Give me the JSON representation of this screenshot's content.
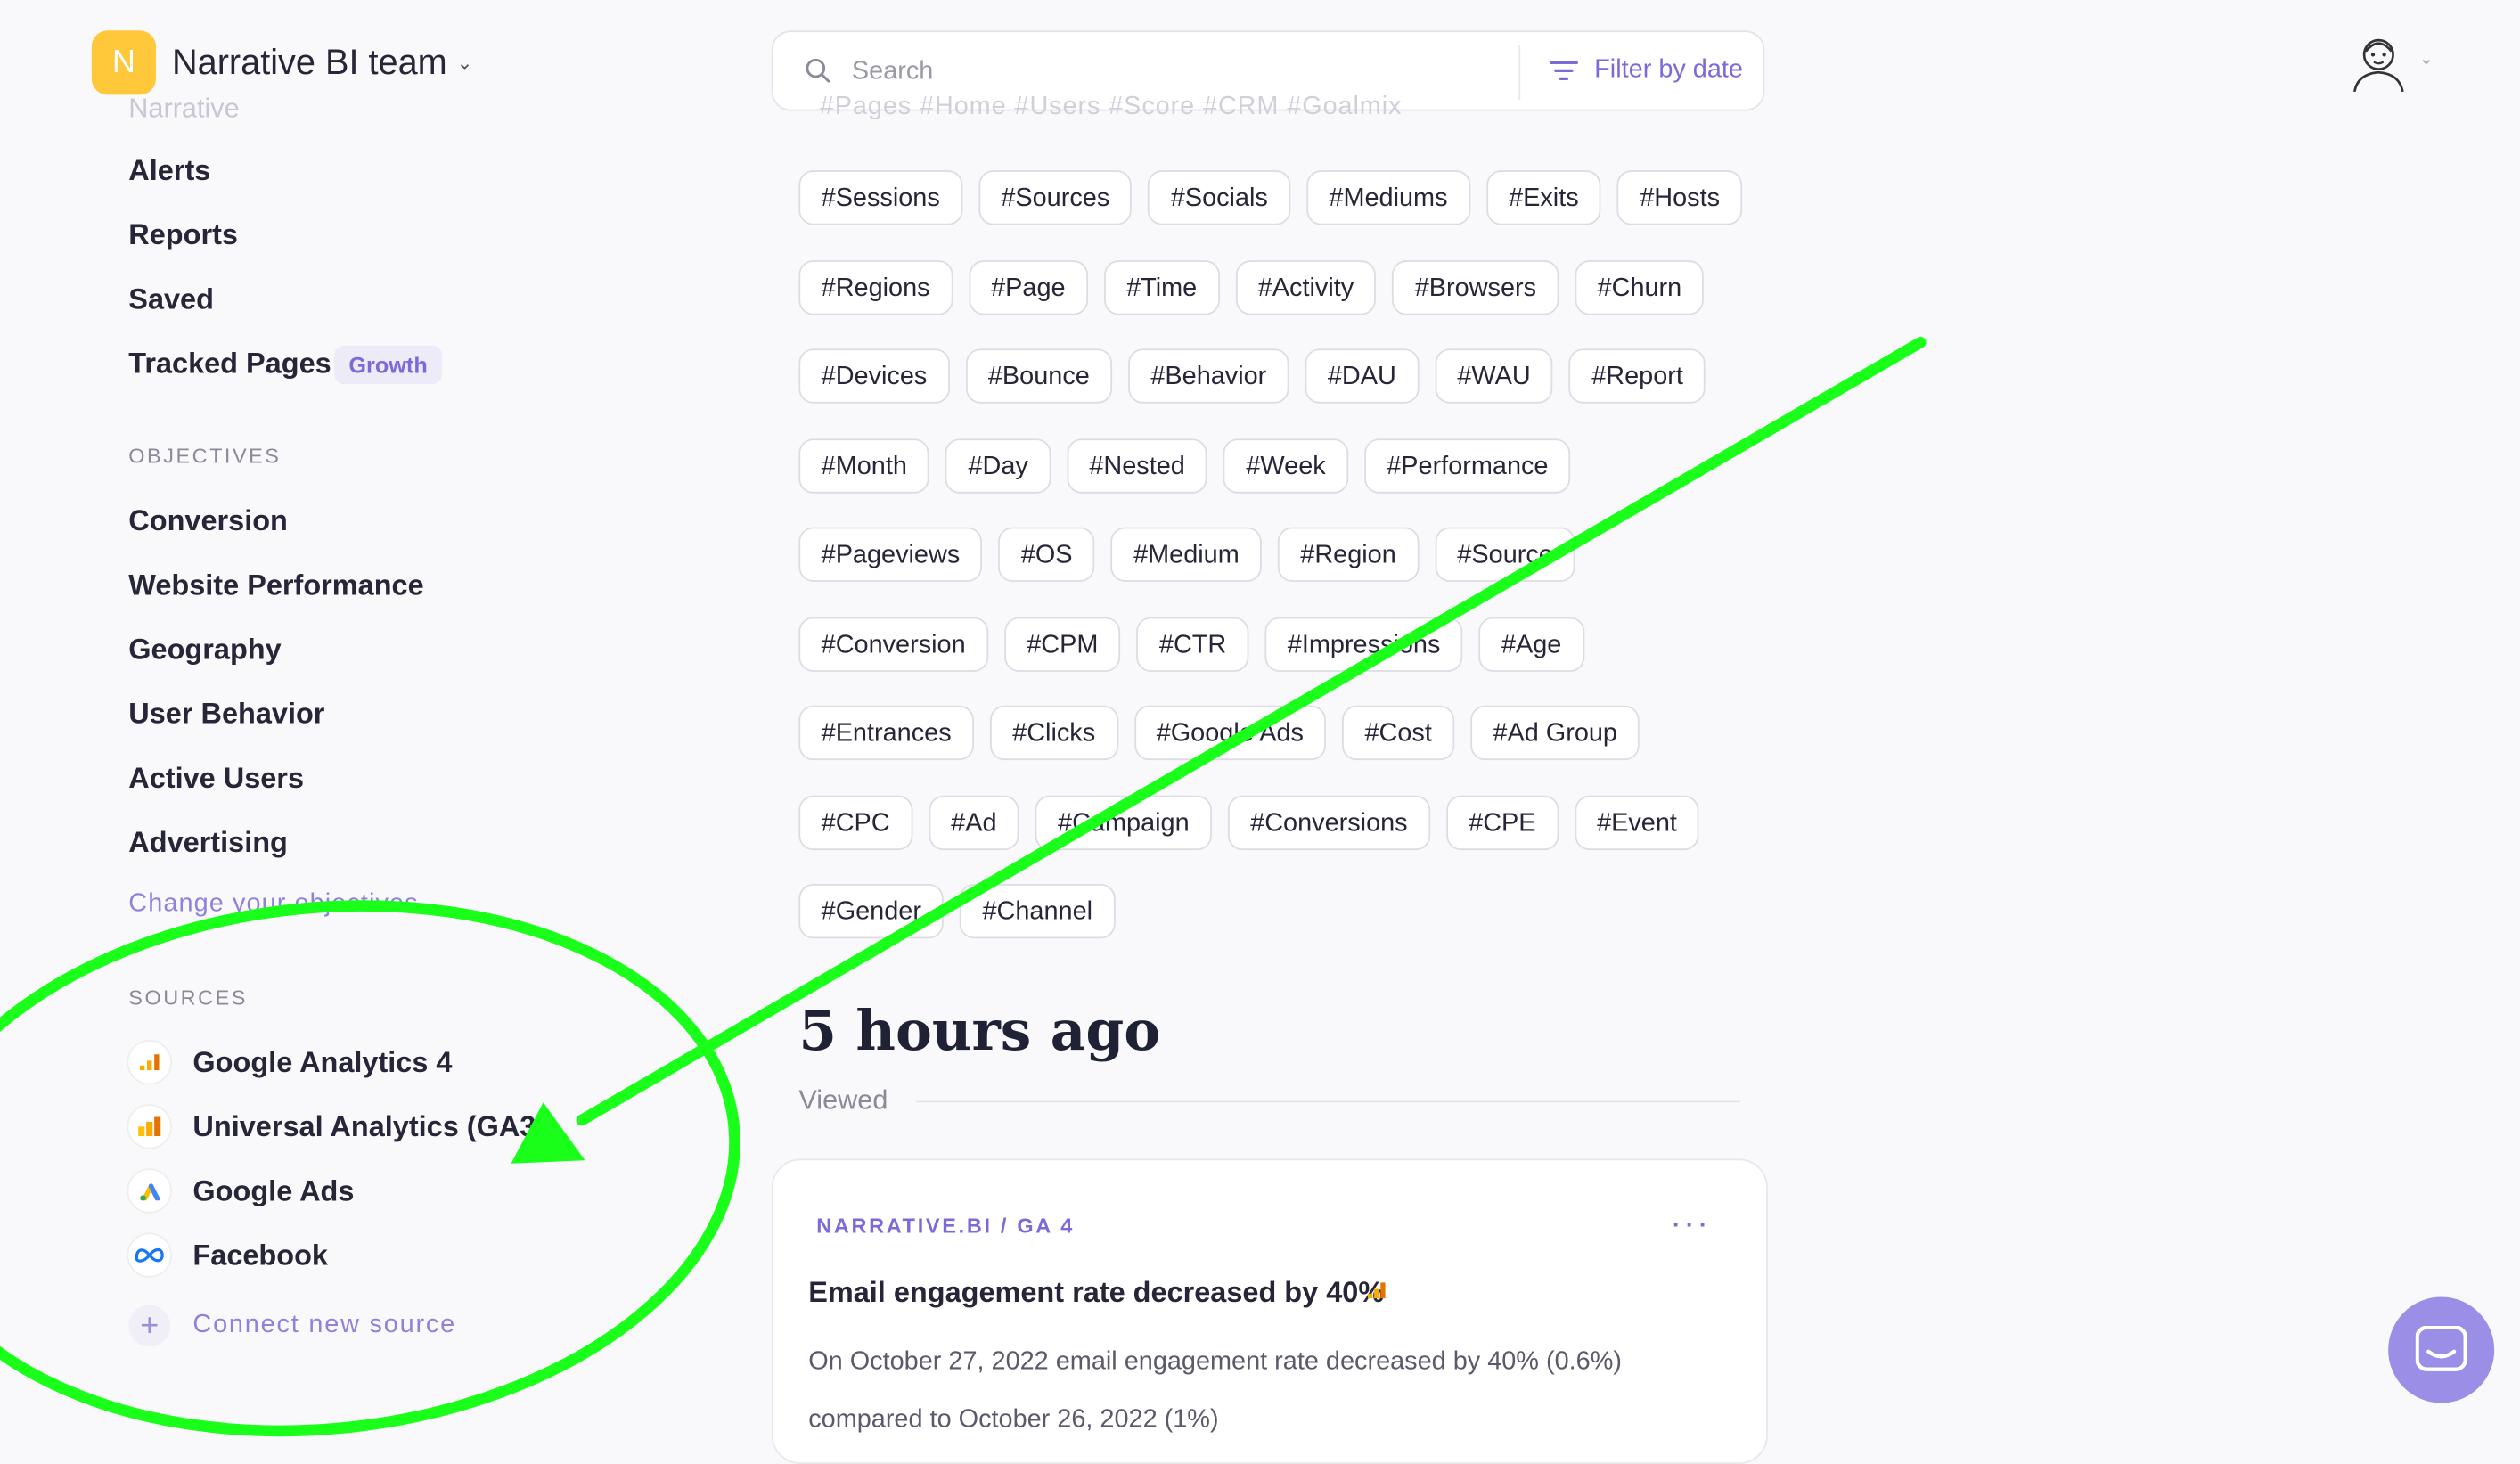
{
  "header": {
    "team_initial": "N",
    "team_name": "Narrative BI team",
    "search_placeholder": "Search",
    "filter_label": "Filter by date"
  },
  "sidebar": {
    "ghost_item": "Narrative",
    "nav_items": [
      "Alerts",
      "Reports",
      "Saved",
      "Tracked Pages"
    ],
    "tracked_badge": "Growth",
    "objectives_label": "OBJECTIVES",
    "objectives": [
      "Conversion",
      "Website Performance",
      "Geography",
      "User Behavior",
      "Active Users",
      "Advertising"
    ],
    "change_link": "Change your objectives",
    "sources_label": "SOURCES",
    "sources": [
      "Google Analytics 4",
      "Universal Analytics (GA3)",
      "Google Ads",
      "Facebook"
    ],
    "connect_label": "Connect new source"
  },
  "tags": {
    "ghost_row": "#Pages   #Home   #Users   #Score   #CRM   #Goalmix",
    "rows": [
      [
        "#Sessions",
        "#Sources",
        "#Socials",
        "#Mediums",
        "#Exits",
        "#Hosts"
      ],
      [
        "#Regions",
        "#Page",
        "#Time",
        "#Activity",
        "#Browsers",
        "#Churn"
      ],
      [
        "#Devices",
        "#Bounce",
        "#Behavior",
        "#DAU",
        "#WAU",
        "#Report"
      ],
      [
        "#Month",
        "#Day",
        "#Nested",
        "#Week",
        "#Performance"
      ],
      [
        "#Pageviews",
        "#OS",
        "#Medium",
        "#Region",
        "#Source"
      ],
      [
        "#Conversion",
        "#CPM",
        "#CTR",
        "#Impressions",
        "#Age"
      ],
      [
        "#Entrances",
        "#Clicks",
        "#Google Ads",
        "#Cost",
        "#Ad Group"
      ],
      [
        "#CPC",
        "#Ad",
        "#Campaign",
        "#Conversions",
        "#CPE",
        "#Event"
      ],
      [
        "#Gender",
        "#Channel"
      ]
    ]
  },
  "timeline": {
    "title": "5 hours ago",
    "subtitle": "Viewed"
  },
  "card": {
    "source": "NARRATIVE.BI / GA 4",
    "more": "···",
    "title": "Email engagement rate decreased by 40%",
    "body": "On October 27, 2022 email engagement rate decreased by 40% (0.6%) compared to October 26, 2022 (1%)"
  },
  "colors": {
    "accent": "#7b6ad8",
    "annotation": "#1aff1a",
    "team_logo": "#ffc83a"
  }
}
